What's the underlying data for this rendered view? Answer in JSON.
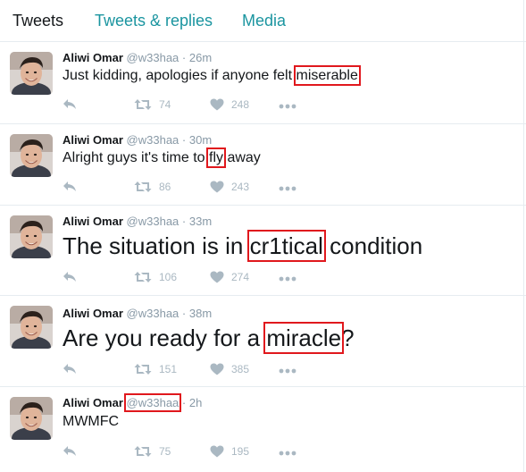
{
  "tabs": [
    {
      "label": "Tweets",
      "active": true
    },
    {
      "label": "Tweets & replies",
      "active": false
    },
    {
      "label": "Media",
      "active": false
    }
  ],
  "tweets": [
    {
      "name": "Aliwi Omar",
      "handle": "@w33haa",
      "separator": "·",
      "time": "26m",
      "text_before": "Just kidding, apologies if anyone felt ",
      "text_highlight": "miserable",
      "text_after": "",
      "retweets": "74",
      "likes": "248"
    },
    {
      "name": "Aliwi Omar",
      "handle": "@w33haa",
      "separator": "·",
      "time": "30m",
      "text_before": "Alright guys it's time to ",
      "text_highlight": "fly",
      "text_after": " away",
      "retweets": "86",
      "likes": "243"
    },
    {
      "name": "Aliwi Omar",
      "handle": "@w33haa",
      "separator": "·",
      "time": "33m",
      "text_before": "The situation is in ",
      "text_highlight": "cr1tical",
      "text_after": " condition",
      "retweets": "106",
      "likes": "274"
    },
    {
      "name": "Aliwi Omar",
      "handle": "@w33haa",
      "separator": "·",
      "time": "38m",
      "text_before": "Are you ready for a ",
      "text_highlight": "miracle",
      "text_after": "?",
      "retweets": "151",
      "likes": "385"
    },
    {
      "name": "Aliwi Omar",
      "handle": "@w33haa",
      "separator": "·",
      "time": "2h",
      "text_before": "MWMFC",
      "text_highlight": "",
      "text_after": "",
      "retweets": "75",
      "likes": "195"
    }
  ],
  "colors": {
    "accent": "#1b95a0",
    "highlight_box": "#e0181d",
    "muted": "#8899a6",
    "icon": "#aab8c2"
  },
  "icons": {
    "reply": "reply-icon",
    "retweet": "retweet-icon",
    "like": "heart-icon",
    "more": "more-dots-icon"
  }
}
